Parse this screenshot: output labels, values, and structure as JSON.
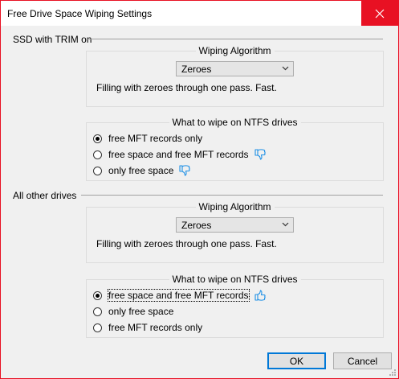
{
  "window": {
    "title": "Free Drive Space Wiping Settings"
  },
  "sections": [
    {
      "label": "SSD with TRIM on",
      "algorithm": {
        "title": "Wiping Algorithm",
        "selected": "Zeroes",
        "description": "Filling with zeroes through one pass. Fast."
      },
      "ntfs": {
        "title": "What to wipe on NTFS drives",
        "options": [
          {
            "label": "free MFT records only",
            "checked": true,
            "thumb": "none"
          },
          {
            "label": "free space and free MFT records",
            "checked": false,
            "thumb": "thumbs-down-icon"
          },
          {
            "label": "only free space",
            "checked": false,
            "thumb": "thumbs-down-icon"
          }
        ]
      }
    },
    {
      "label": "All other drives",
      "algorithm": {
        "title": "Wiping Algorithm",
        "selected": "Zeroes",
        "description": "Filling with zeroes through one pass. Fast."
      },
      "ntfs": {
        "title": "What to wipe on NTFS drives",
        "options": [
          {
            "label": "free space and free MFT records",
            "checked": true,
            "thumb": "thumbs-up-icon"
          },
          {
            "label": "only free space",
            "checked": false,
            "thumb": "none"
          },
          {
            "label": "free MFT records only",
            "checked": false,
            "thumb": "none"
          }
        ]
      }
    }
  ],
  "buttons": {
    "ok": "OK",
    "cancel": "Cancel"
  },
  "colors": {
    "close_button": "#e81123",
    "thumb": "#1e90e6",
    "default_button_border": "#0078d7"
  }
}
